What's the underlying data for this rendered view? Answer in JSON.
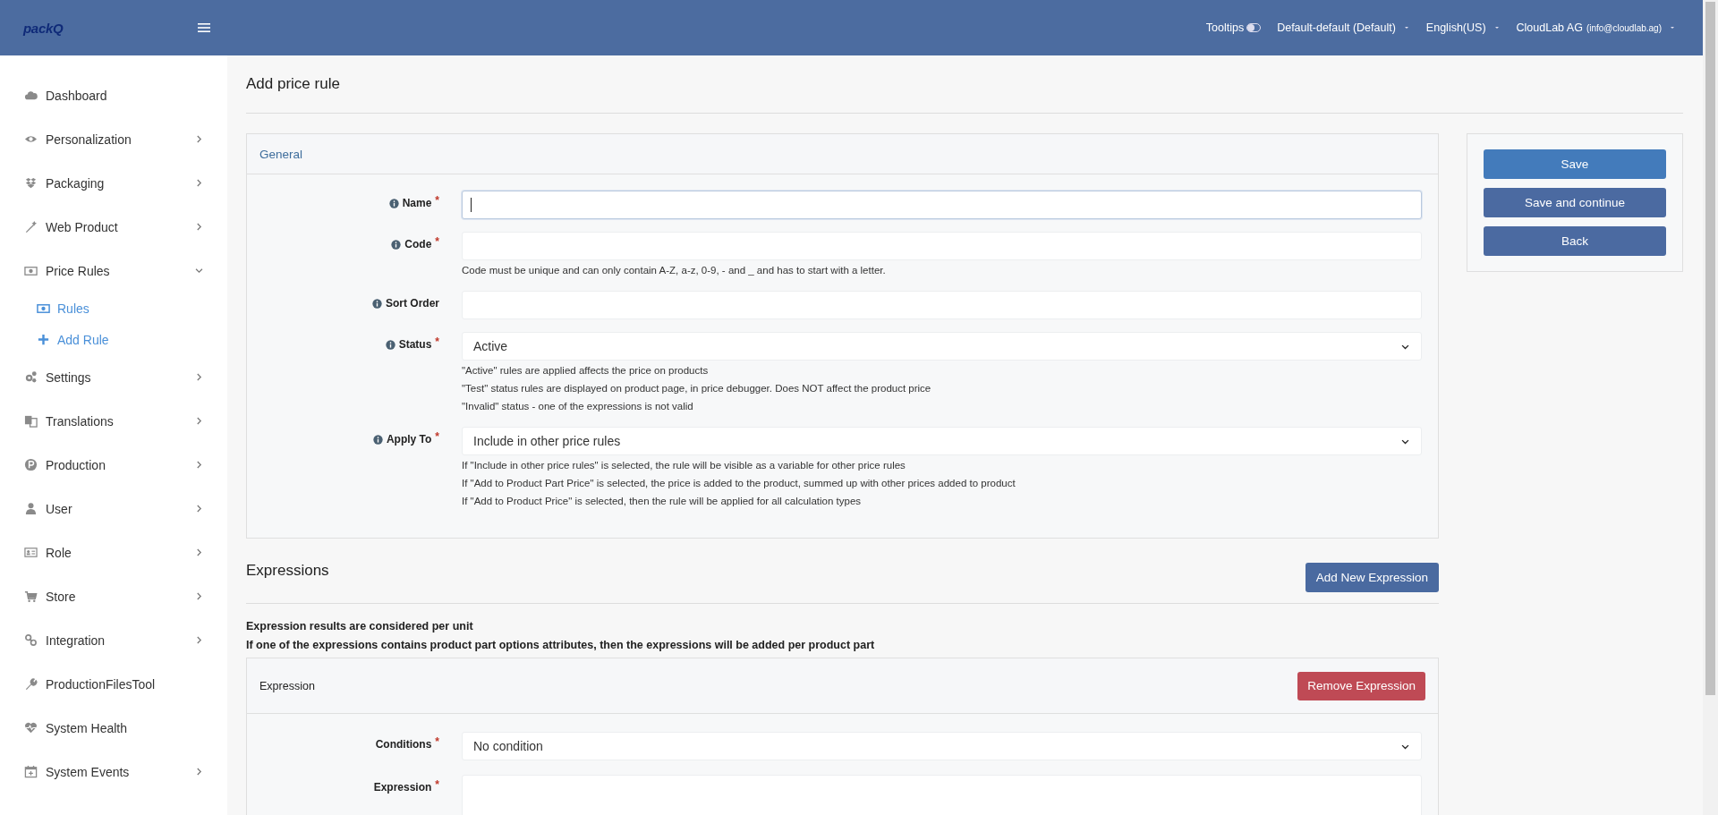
{
  "topbar": {
    "logo": "packQ",
    "tooltips": {
      "label": "Tooltips",
      "on": false
    },
    "menus": [
      "Default-default (Default)",
      "English(US)"
    ],
    "user": {
      "name": "CloudLab AG",
      "email": "(info@cloudlab.ag)"
    }
  },
  "sidebar": {
    "items": [
      {
        "label": "Dashboard"
      },
      {
        "label": "Personalization",
        "expanded": false
      },
      {
        "label": "Packaging",
        "expanded": false
      },
      {
        "label": "Web Product",
        "expanded": false
      },
      {
        "label": "Price Rules",
        "expanded": true,
        "children": [
          {
            "label": "Rules",
            "kind": "list"
          },
          {
            "label": "Add Rule",
            "kind": "add"
          }
        ]
      },
      {
        "label": "Settings",
        "expanded": false
      },
      {
        "label": "Translations",
        "expanded": false
      },
      {
        "label": "Production",
        "expanded": false
      },
      {
        "label": "User",
        "expanded": false
      },
      {
        "label": "Role",
        "expanded": false
      },
      {
        "label": "Store",
        "expanded": false
      },
      {
        "label": "Integration",
        "expanded": false
      },
      {
        "label": "ProductionFilesTool"
      },
      {
        "label": "System Health"
      },
      {
        "label": "System Events",
        "expanded": false
      }
    ]
  },
  "page": {
    "title": "Add price rule"
  },
  "general": {
    "title": "General",
    "fields": [
      {
        "kind": "text",
        "label": "Name",
        "required": "*",
        "focused": true
      },
      {
        "kind": "text",
        "label": "Code",
        "required": "*",
        "focused": false,
        "help": [
          "Code must be unique and can only contain A-Z, a-z, 0-9, - and _ and has to start with a letter."
        ]
      },
      {
        "kind": "text",
        "label": "Sort Order",
        "focused": false
      },
      {
        "kind": "select",
        "label": "Status",
        "required": "*",
        "value": "Active",
        "help": [
          "\"Active\" rules are applied affects the price on products",
          "\"Test\" status rules are displayed on product page, in price debugger. Does NOT affect the product price",
          "\"Invalid\" status - one of the expressions is not valid"
        ]
      },
      {
        "kind": "select",
        "label": "Apply To",
        "required": "*",
        "value": "Include in other price rules",
        "help": [
          "If \"Include in other price rules\" is selected, the rule will be visible as a variable for other price rules",
          "If \"Add to Product Part Price\" is selected, the price is added to the product, summed up with other prices added to product",
          "If \"Add to Product Price\" is selected, then the rule will be applied for all calculation types"
        ]
      }
    ]
  },
  "actions": [
    "Save",
    "Save and continue",
    "Back"
  ],
  "expressions": {
    "title": "Expressions",
    "add_button": "Add New Expression",
    "notes": [
      "Expression results are considered per unit",
      "If one of the expressions contains product part options attributes, then the expressions will be added per product part"
    ],
    "items": [
      {
        "title": "Expression",
        "remove_button": "Remove Expression",
        "fields": [
          {
            "kind": "select",
            "label": "Conditions",
            "required": "*",
            "value": "No condition"
          },
          {
            "kind": "textarea",
            "label": "Expression",
            "required": "*"
          }
        ]
      }
    ]
  }
}
